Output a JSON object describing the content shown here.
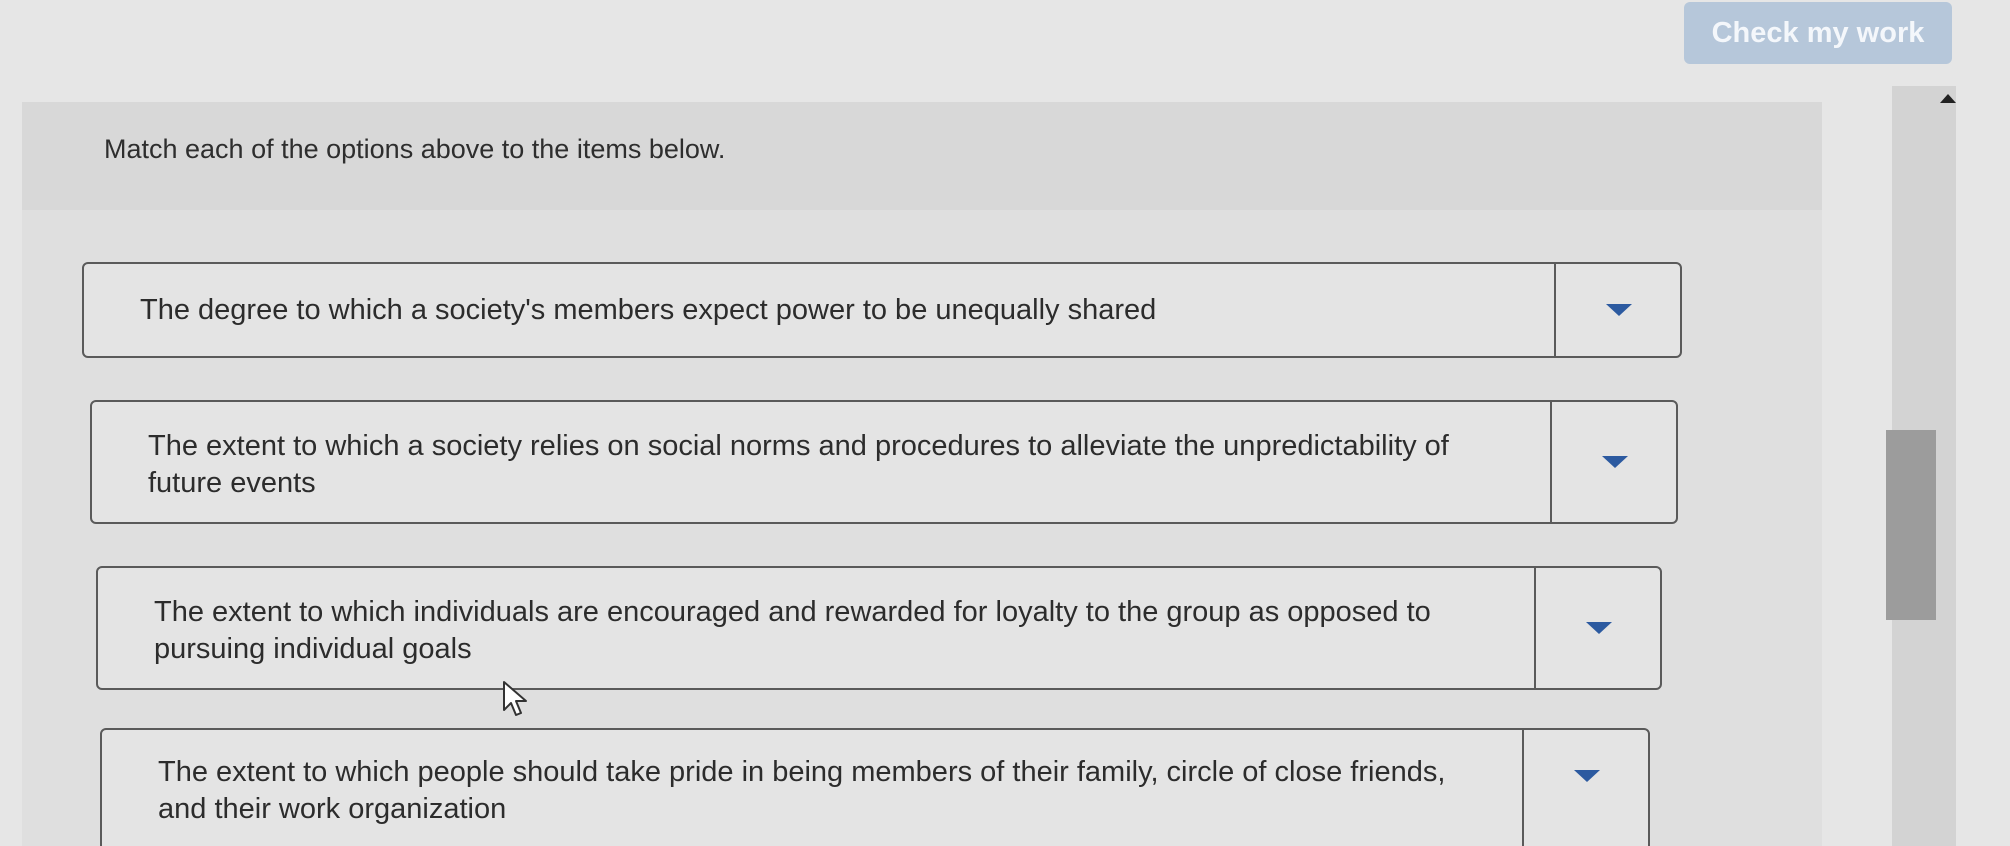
{
  "header": {
    "check_button_label": "Check my work"
  },
  "question": {
    "instruction": "Match each of the options above to the items below.",
    "items": [
      {
        "prompt": "The degree to which a society's members expect power to be unequally shared",
        "selected": ""
      },
      {
        "prompt": "The extent to which a society relies on social norms and procedures to alleviate the unpredictability of future events",
        "selected": ""
      },
      {
        "prompt": "The extent to which individuals are encouraged and rewarded for loyalty to the group as opposed to pursuing individual goals",
        "selected": ""
      },
      {
        "prompt": "The extent to which people should take pride in being members of their family, circle of close friends, and their work organization",
        "selected": ""
      }
    ]
  },
  "icons": {
    "dropdown": "caret-down-icon",
    "scroll_up": "triangle-up-icon",
    "cursor": "mouse-pointer-icon"
  },
  "colors": {
    "button_bg": "#b6c7da",
    "caret": "#2c5aa0",
    "panel_bg": "#dfdfdf"
  }
}
